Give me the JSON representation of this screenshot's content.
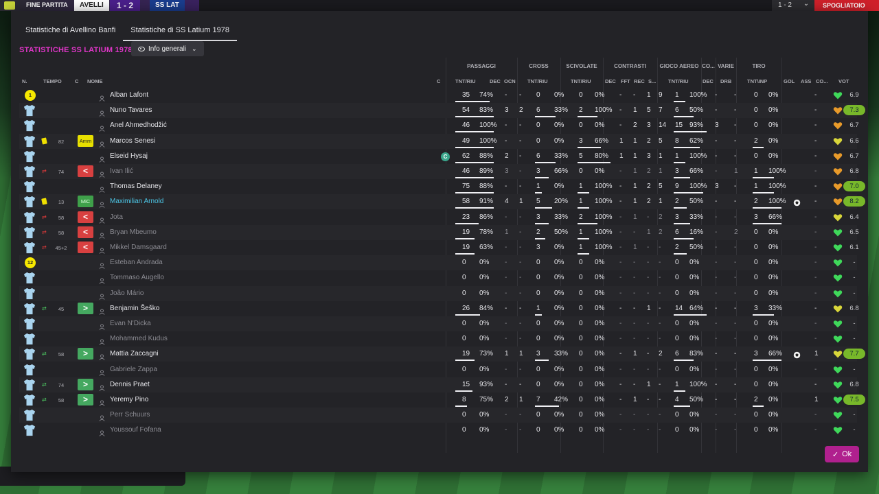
{
  "topbar": {
    "label": "FINE PARTITA",
    "team1": "AVELLI",
    "score": "1 - 2",
    "team2": "SS LAT",
    "right_score": "1 - 2",
    "exit_label": "SPOGLIATOIO"
  },
  "tabs": [
    {
      "label": "Statistiche di Avellino Banfi",
      "active": false
    },
    {
      "label": "Statistiche di SS Latium 1978",
      "active": true
    }
  ],
  "section_title": "STATISTICHE SS LATIUM 1978",
  "view_button": "Info generali",
  "groups": {
    "passaggi": "PASSAGGI",
    "cross": "CROSS",
    "scivolate": "SCIVOLATE",
    "contrasti": "CONTRASTI",
    "gioco_aereo": "GIOCO AEREO",
    "co": "CO...",
    "varie": "VARIE",
    "tiro": "TIRO"
  },
  "headers": {
    "n": "N.",
    "tempo": "TEMPO",
    "c": "C",
    "nome": "NOME",
    "capt": "C",
    "pass_tnt": "TNT/RIU",
    "dec": "DEC",
    "ocn": "OCN",
    "cross_tnt": "TNT/RIU",
    "sciv_tnt": "TNT/RIU",
    "c_dec": "DEC",
    "fft": "FFT",
    "rec": "REC",
    "s": "S...",
    "aereo_tnt": "TNT/RIU",
    "co_dec": "DEC",
    "drb": "DRB",
    "tiro": "TNT\\INP",
    "gol": "GOL",
    "ass": "ASS",
    "co2": "CO...",
    "vot": "VOT"
  },
  "players": [
    {
      "num": "1",
      "card": "",
      "sub": "",
      "min": "",
      "pos": "",
      "name": "Alban Lafont",
      "style": "",
      "capt": false,
      "p": [
        "35",
        "74%"
      ],
      "pdec": "-",
      "pocn": "-",
      "cr": [
        "0",
        "0%"
      ],
      "sc": [
        "0",
        "0%"
      ],
      "cdec": "-",
      "fft": "-",
      "rec": "1",
      "s": "9",
      "ga": [
        "1",
        "100%"
      ],
      "codec": "-",
      "drb": "-",
      "ti": [
        "0",
        "0%"
      ],
      "gol": "",
      "ass": "-",
      "heart": "green",
      "vot": "6.9",
      "votpill": false,
      "bars": {
        "p": 0.9,
        "cr": 0,
        "sc": 0,
        "ga": 0.35,
        "ti": 0
      }
    },
    {
      "num": "",
      "card": "",
      "sub": "",
      "min": "",
      "pos": "",
      "name": "Nuno Tavares",
      "style": "",
      "capt": false,
      "p": [
        "54",
        "83%"
      ],
      "pdec": "3",
      "pocn": "2",
      "cr": [
        "6",
        "33%"
      ],
      "sc": [
        "2",
        "100%"
      ],
      "cdec": "-",
      "fft": "1",
      "rec": "5",
      "s": "7",
      "ga": [
        "6",
        "50%"
      ],
      "codec": "-",
      "drb": "-",
      "ti": [
        "0",
        "0%"
      ],
      "gol": "",
      "ass": "-",
      "heart": "orange",
      "vot": "7.3",
      "votpill": true,
      "bars": {
        "p": 1,
        "cr": 0.6,
        "sc": 0.6,
        "ga": 0.6,
        "ti": 0
      }
    },
    {
      "num": "",
      "card": "",
      "sub": "",
      "min": "",
      "pos": "",
      "name": "Anel Ahmedhodžić",
      "style": "",
      "capt": false,
      "p": [
        "46",
        "100%"
      ],
      "pdec": "-",
      "pocn": "-",
      "cr": [
        "0",
        "0%"
      ],
      "sc": [
        "0",
        "0%"
      ],
      "cdec": "-",
      "fft": "2",
      "rec": "3",
      "s": "14",
      "ga": [
        "15",
        "93%"
      ],
      "codec": "3",
      "drb": "-",
      "ti": [
        "0",
        "0%"
      ],
      "gol": "",
      "ass": "-",
      "heart": "orange",
      "vot": "6.7",
      "votpill": false,
      "bars": {
        "p": 1,
        "cr": 0,
        "sc": 0,
        "ga": 1,
        "ti": 0
      }
    },
    {
      "num": "",
      "card": "y",
      "sub": "",
      "min": "82",
      "pos": "Amm",
      "name": "Marcos Senesi",
      "style": "",
      "capt": false,
      "p": [
        "49",
        "100%"
      ],
      "pdec": "-",
      "pocn": "-",
      "cr": [
        "0",
        "0%"
      ],
      "sc": [
        "3",
        "66%"
      ],
      "cdec": "1",
      "fft": "1",
      "rec": "2",
      "s": "5",
      "ga": [
        "8",
        "62%"
      ],
      "codec": "-",
      "drb": "-",
      "ti": [
        "2",
        "0%"
      ],
      "gol": "",
      "ass": "-",
      "heart": "yellow",
      "vot": "6.6",
      "votpill": false,
      "bars": {
        "p": 1,
        "cr": 0,
        "sc": 0.7,
        "ga": 0.8,
        "ti": 0.3
      }
    },
    {
      "num": "",
      "card": "",
      "sub": "",
      "min": "",
      "pos": "",
      "name": "Elseid Hysaj",
      "style": "",
      "capt": true,
      "p": [
        "62",
        "88%"
      ],
      "pdec": "2",
      "pocn": "-",
      "cr": [
        "6",
        "33%"
      ],
      "sc": [
        "5",
        "80%"
      ],
      "cdec": "1",
      "fft": "1",
      "rec": "3",
      "s": "1",
      "ga": [
        "1",
        "100%"
      ],
      "codec": "-",
      "drb": "-",
      "ti": [
        "0",
        "0%"
      ],
      "gol": "",
      "ass": "-",
      "heart": "orange",
      "vot": "6.7",
      "votpill": false,
      "bars": {
        "p": 1,
        "cr": 0.6,
        "sc": 1,
        "ga": 0.35,
        "ti": 0
      }
    },
    {
      "num": "",
      "card": "",
      "sub": "out",
      "min": "74",
      "pos": "out",
      "name": "Ivan Ilić",
      "style": "dim",
      "capt": false,
      "p": [
        "46",
        "89%"
      ],
      "pdec": "3",
      "pocn": "-",
      "cr": [
        "3",
        "66%"
      ],
      "sc": [
        "0",
        "0%"
      ],
      "cdec": "-",
      "fft": "1",
      "rec": "2",
      "s": "1",
      "ga": [
        "3",
        "66%"
      ],
      "codec": "-",
      "drb": "1",
      "ti": [
        "1",
        "100%"
      ],
      "gol": "",
      "ass": "-",
      "heart": "orange",
      "vot": "6.8",
      "votpill": false,
      "bars": {
        "p": 1,
        "cr": 0.4,
        "sc": 0,
        "ga": 0.5,
        "ti": 0.6
      }
    },
    {
      "num": "",
      "card": "",
      "sub": "",
      "min": "",
      "pos": "",
      "name": "Thomas Delaney",
      "style": "",
      "capt": false,
      "p": [
        "75",
        "88%"
      ],
      "pdec": "-",
      "pocn": "-",
      "cr": [
        "1",
        "0%"
      ],
      "sc": [
        "1",
        "100%"
      ],
      "cdec": "-",
      "fft": "1",
      "rec": "2",
      "s": "5",
      "ga": [
        "9",
        "100%"
      ],
      "codec": "3",
      "drb": "-",
      "ti": [
        "1",
        "100%"
      ],
      "gol": "",
      "ass": "-",
      "heart": "orange",
      "vot": "7.0",
      "votpill": true,
      "bars": {
        "p": 1,
        "cr": 0.2,
        "sc": 0.35,
        "ga": 0.9,
        "ti": 0.6
      }
    },
    {
      "num": "",
      "card": "y",
      "sub": "",
      "min": "13",
      "pos": "MiC",
      "name": "Maximilian Arnold",
      "style": "hl",
      "capt": false,
      "p": [
        "58",
        "91%"
      ],
      "pdec": "4",
      "pocn": "1",
      "cr": [
        "5",
        "20%"
      ],
      "sc": [
        "1",
        "100%"
      ],
      "cdec": "-",
      "fft": "1",
      "rec": "2",
      "s": "1",
      "ga": [
        "2",
        "50%"
      ],
      "codec": "-",
      "drb": "-",
      "ti": [
        "2",
        "100%"
      ],
      "gol": "ball",
      "ass": "-",
      "heart": "orange",
      "vot": "8.2",
      "votpill": true,
      "bars": {
        "p": 1,
        "cr": 0.5,
        "sc": 0.35,
        "ga": 0.4,
        "ti": 0.8
      }
    },
    {
      "num": "",
      "card": "",
      "sub": "out",
      "min": "58",
      "pos": "out",
      "name": "Jota",
      "style": "dim",
      "capt": false,
      "p": [
        "23",
        "86%"
      ],
      "pdec": "-",
      "pocn": "-",
      "cr": [
        "3",
        "33%"
      ],
      "sc": [
        "2",
        "100%"
      ],
      "cdec": "-",
      "fft": "1",
      "rec": "-",
      "s": "2",
      "ga": [
        "3",
        "33%"
      ],
      "codec": "-",
      "drb": "-",
      "ti": [
        "3",
        "66%"
      ],
      "gol": "",
      "ass": "-",
      "heart": "yellow",
      "vot": "6.4",
      "votpill": false,
      "bars": {
        "p": 0.6,
        "cr": 0.4,
        "sc": 0.6,
        "ga": 0.5,
        "ti": 0.8
      }
    },
    {
      "num": "",
      "card": "",
      "sub": "out",
      "min": "58",
      "pos": "out",
      "name": "Bryan Mbeumo",
      "style": "dim",
      "capt": false,
      "p": [
        "19",
        "78%"
      ],
      "pdec": "1",
      "pocn": "-",
      "cr": [
        "2",
        "50%"
      ],
      "sc": [
        "1",
        "100%"
      ],
      "cdec": "-",
      "fft": "-",
      "rec": "1",
      "s": "2",
      "ga": [
        "6",
        "16%"
      ],
      "codec": "-",
      "drb": "2",
      "ti": [
        "0",
        "0%"
      ],
      "gol": "",
      "ass": "-",
      "heart": "green",
      "vot": "6.5",
      "votpill": false,
      "bars": {
        "p": 0.5,
        "cr": 0.3,
        "sc": 0.35,
        "ga": 0.6,
        "ti": 0
      }
    },
    {
      "num": "",
      "card": "",
      "sub": "out",
      "min": "45+2",
      "pos": "out",
      "name": "Mikkel Damsgaard",
      "style": "dim",
      "capt": false,
      "p": [
        "19",
        "63%"
      ],
      "pdec": "-",
      "pocn": "-",
      "cr": [
        "3",
        "0%"
      ],
      "sc": [
        "1",
        "100%"
      ],
      "cdec": "-",
      "fft": "1",
      "rec": "-",
      "s": "-",
      "ga": [
        "2",
        "50%"
      ],
      "codec": "-",
      "drb": "-",
      "ti": [
        "0",
        "0%"
      ],
      "gol": "",
      "ass": "-",
      "heart": "green",
      "vot": "6.1",
      "votpill": false,
      "bars": {
        "p": 0.5,
        "cr": 0,
        "sc": 0.35,
        "ga": 0.4,
        "ti": 0
      }
    },
    {
      "num": "12",
      "card": "",
      "sub": "",
      "min": "",
      "pos": "",
      "name": "Esteban Andrada",
      "style": "dim",
      "capt": false,
      "p": [
        "0",
        "0%"
      ],
      "pdec": "-",
      "pocn": "-",
      "cr": [
        "0",
        "0%"
      ],
      "sc": [
        "0",
        "0%"
      ],
      "cdec": "-",
      "fft": "-",
      "rec": "-",
      "s": "-",
      "ga": [
        "0",
        "0%"
      ],
      "codec": "-",
      "drb": "-",
      "ti": [
        "0",
        "0%"
      ],
      "gol": "",
      "ass": "-",
      "heart": "green",
      "vot": "-",
      "votpill": false,
      "bars": {
        "p": 0,
        "cr": 0,
        "sc": 0,
        "ga": 0,
        "ti": 0
      }
    },
    {
      "num": "",
      "card": "",
      "sub": "",
      "min": "",
      "pos": "",
      "name": "Tommaso Augello",
      "style": "dim",
      "capt": false,
      "p": [
        "0",
        "0%"
      ],
      "pdec": "-",
      "pocn": "-",
      "cr": [
        "0",
        "0%"
      ],
      "sc": [
        "0",
        "0%"
      ],
      "cdec": "-",
      "fft": "-",
      "rec": "-",
      "s": "-",
      "ga": [
        "0",
        "0%"
      ],
      "codec": "-",
      "drb": "-",
      "ti": [
        "0",
        "0%"
      ],
      "gol": "",
      "ass": "-",
      "heart": "green",
      "vot": "-",
      "votpill": false,
      "bars": {
        "p": 0,
        "cr": 0,
        "sc": 0,
        "ga": 0,
        "ti": 0
      }
    },
    {
      "num": "",
      "card": "",
      "sub": "",
      "min": "",
      "pos": "",
      "name": "João Mário",
      "style": "dim",
      "capt": false,
      "p": [
        "0",
        "0%"
      ],
      "pdec": "-",
      "pocn": "-",
      "cr": [
        "0",
        "0%"
      ],
      "sc": [
        "0",
        "0%"
      ],
      "cdec": "-",
      "fft": "-",
      "rec": "-",
      "s": "-",
      "ga": [
        "0",
        "0%"
      ],
      "codec": "-",
      "drb": "-",
      "ti": [
        "0",
        "0%"
      ],
      "gol": "",
      "ass": "-",
      "heart": "green",
      "vot": "-",
      "votpill": false,
      "bars": {
        "p": 0,
        "cr": 0,
        "sc": 0,
        "ga": 0,
        "ti": 0
      }
    },
    {
      "num": "",
      "card": "",
      "sub": "in",
      "min": "45",
      "pos": "in",
      "name": "Benjamin Šeško",
      "style": "",
      "capt": false,
      "p": [
        "26",
        "84%"
      ],
      "pdec": "-",
      "pocn": "-",
      "cr": [
        "1",
        "0%"
      ],
      "sc": [
        "0",
        "0%"
      ],
      "cdec": "-",
      "fft": "-",
      "rec": "1",
      "s": "-",
      "ga": [
        "14",
        "64%"
      ],
      "codec": "-",
      "drb": "-",
      "ti": [
        "3",
        "33%"
      ],
      "gol": "",
      "ass": "-",
      "heart": "yellow",
      "vot": "6.8",
      "votpill": false,
      "bars": {
        "p": 0.65,
        "cr": 0.2,
        "sc": 0,
        "ga": 1,
        "ti": 0.6
      }
    },
    {
      "num": "",
      "card": "",
      "sub": "",
      "min": "",
      "pos": "",
      "name": "Evan N'Dicka",
      "style": "dim",
      "capt": false,
      "p": [
        "0",
        "0%"
      ],
      "pdec": "-",
      "pocn": "-",
      "cr": [
        "0",
        "0%"
      ],
      "sc": [
        "0",
        "0%"
      ],
      "cdec": "-",
      "fft": "-",
      "rec": "-",
      "s": "-",
      "ga": [
        "0",
        "0%"
      ],
      "codec": "-",
      "drb": "-",
      "ti": [
        "0",
        "0%"
      ],
      "gol": "",
      "ass": "-",
      "heart": "green",
      "vot": "-",
      "votpill": false,
      "bars": {
        "p": 0,
        "cr": 0,
        "sc": 0,
        "ga": 0,
        "ti": 0
      }
    },
    {
      "num": "",
      "card": "",
      "sub": "",
      "min": "",
      "pos": "",
      "name": "Mohammed Kudus",
      "style": "dim",
      "capt": false,
      "p": [
        "0",
        "0%"
      ],
      "pdec": "-",
      "pocn": "-",
      "cr": [
        "0",
        "0%"
      ],
      "sc": [
        "0",
        "0%"
      ],
      "cdec": "-",
      "fft": "-",
      "rec": "-",
      "s": "-",
      "ga": [
        "0",
        "0%"
      ],
      "codec": "-",
      "drb": "-",
      "ti": [
        "0",
        "0%"
      ],
      "gol": "",
      "ass": "-",
      "heart": "green",
      "vot": "-",
      "votpill": false,
      "bars": {
        "p": 0,
        "cr": 0,
        "sc": 0,
        "ga": 0,
        "ti": 0
      }
    },
    {
      "num": "",
      "card": "",
      "sub": "in",
      "min": "58",
      "pos": "in",
      "name": "Mattia Zaccagni",
      "style": "",
      "capt": false,
      "p": [
        "19",
        "73%"
      ],
      "pdec": "1",
      "pocn": "1",
      "cr": [
        "3",
        "33%"
      ],
      "sc": [
        "0",
        "0%"
      ],
      "cdec": "-",
      "fft": "1",
      "rec": "-",
      "s": "2",
      "ga": [
        "6",
        "83%"
      ],
      "codec": "-",
      "drb": "-",
      "ti": [
        "3",
        "66%"
      ],
      "gol": "ball",
      "ass": "1",
      "heart": "yellow",
      "vot": "7.7",
      "votpill": true,
      "bars": {
        "p": 0.5,
        "cr": 0.4,
        "sc": 0,
        "ga": 0.6,
        "ti": 0.8
      }
    },
    {
      "num": "",
      "card": "",
      "sub": "",
      "min": "",
      "pos": "",
      "name": "Gabriele Zappa",
      "style": "dim",
      "capt": false,
      "p": [
        "0",
        "0%"
      ],
      "pdec": "-",
      "pocn": "-",
      "cr": [
        "0",
        "0%"
      ],
      "sc": [
        "0",
        "0%"
      ],
      "cdec": "-",
      "fft": "-",
      "rec": "-",
      "s": "-",
      "ga": [
        "0",
        "0%"
      ],
      "codec": "-",
      "drb": "-",
      "ti": [
        "0",
        "0%"
      ],
      "gol": "",
      "ass": "-",
      "heart": "green",
      "vot": "-",
      "votpill": false,
      "bars": {
        "p": 0,
        "cr": 0,
        "sc": 0,
        "ga": 0,
        "ti": 0
      }
    },
    {
      "num": "",
      "card": "",
      "sub": "in",
      "min": "74",
      "pos": "in",
      "name": "Dennis Praet",
      "style": "",
      "capt": false,
      "p": [
        "15",
        "93%"
      ],
      "pdec": "-",
      "pocn": "-",
      "cr": [
        "0",
        "0%"
      ],
      "sc": [
        "0",
        "0%"
      ],
      "cdec": "-",
      "fft": "-",
      "rec": "1",
      "s": "-",
      "ga": [
        "1",
        "100%"
      ],
      "codec": "-",
      "drb": "-",
      "ti": [
        "0",
        "0%"
      ],
      "gol": "",
      "ass": "-",
      "heart": "green",
      "vot": "6.8",
      "votpill": false,
      "bars": {
        "p": 0.45,
        "cr": 0,
        "sc": 0,
        "ga": 0.35,
        "ti": 0
      }
    },
    {
      "num": "",
      "card": "",
      "sub": "in",
      "min": "58",
      "pos": "in",
      "name": "Yeremy Pino",
      "style": "",
      "capt": false,
      "p": [
        "8",
        "75%"
      ],
      "pdec": "2",
      "pocn": "1",
      "cr": [
        "7",
        "42%"
      ],
      "sc": [
        "0",
        "0%"
      ],
      "cdec": "-",
      "fft": "1",
      "rec": "-",
      "s": "-",
      "ga": [
        "4",
        "50%"
      ],
      "codec": "-",
      "drb": "-",
      "ti": [
        "2",
        "0%"
      ],
      "gol": "",
      "ass": "1",
      "heart": "green",
      "vot": "7.5",
      "votpill": true,
      "bars": {
        "p": 0.3,
        "cr": 0.7,
        "sc": 0,
        "ga": 0.5,
        "ti": 0.3
      }
    },
    {
      "num": "",
      "card": "",
      "sub": "",
      "min": "",
      "pos": "",
      "name": "Perr Schuurs",
      "style": "dim",
      "capt": false,
      "p": [
        "0",
        "0%"
      ],
      "pdec": "-",
      "pocn": "-",
      "cr": [
        "0",
        "0%"
      ],
      "sc": [
        "0",
        "0%"
      ],
      "cdec": "-",
      "fft": "-",
      "rec": "-",
      "s": "-",
      "ga": [
        "0",
        "0%"
      ],
      "codec": "-",
      "drb": "-",
      "ti": [
        "0",
        "0%"
      ],
      "gol": "",
      "ass": "-",
      "heart": "green",
      "vot": "-",
      "votpill": false,
      "bars": {
        "p": 0,
        "cr": 0,
        "sc": 0,
        "ga": 0,
        "ti": 0
      }
    },
    {
      "num": "",
      "card": "",
      "sub": "",
      "min": "",
      "pos": "",
      "name": "Youssouf Fofana",
      "style": "dim",
      "capt": false,
      "p": [
        "0",
        "0%"
      ],
      "pdec": "-",
      "pocn": "-",
      "cr": [
        "0",
        "0%"
      ],
      "sc": [
        "0",
        "0%"
      ],
      "cdec": "-",
      "fft": "-",
      "rec": "-",
      "s": "-",
      "ga": [
        "0",
        "0%"
      ],
      "codec": "-",
      "drb": "-",
      "ti": [
        "0",
        "0%"
      ],
      "gol": "",
      "ass": "-",
      "heart": "green",
      "vot": "-",
      "votpill": false,
      "bars": {
        "p": 0,
        "cr": 0,
        "sc": 0,
        "ga": 0,
        "ti": 0
      }
    }
  ],
  "position_labels": {
    "out": "<",
    "in": ">"
  },
  "captain_label": "C",
  "ok_button": "Ok",
  "colors": {
    "accent": "#e036c8",
    "ok": "#b0208e",
    "shirt": "#a9d4ef",
    "heart_green": "#3fd85a",
    "heart_orange": "#e89a2a",
    "heart_yellow": "#d8d63a",
    "vote_pill": "#78b82a"
  }
}
